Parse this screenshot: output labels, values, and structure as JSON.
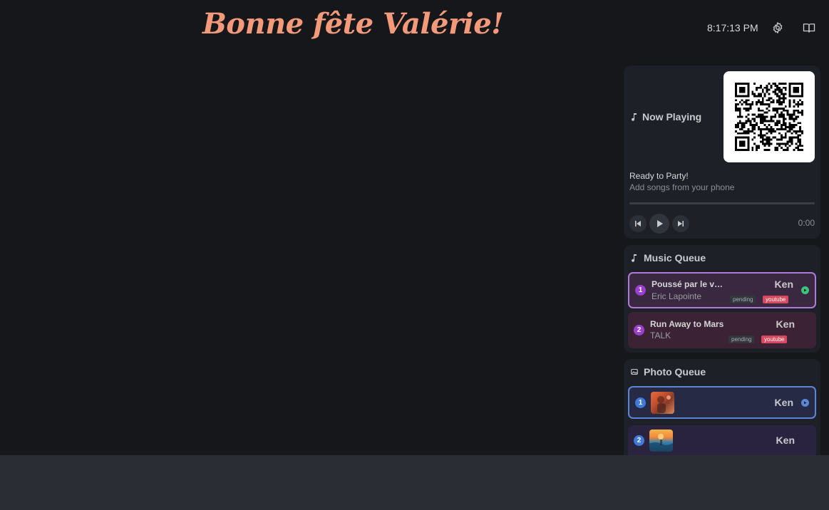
{
  "header": {
    "title": "Bonne fête Valérie!",
    "clock": "8:17:13 PM",
    "icons": [
      "gear-icon",
      "book-icon"
    ]
  },
  "now_playing": {
    "title": "Now Playing",
    "status": "Ready to Party!",
    "subtitle": "Add songs from your phone",
    "time": "0:00",
    "progress": 0
  },
  "music_queue": {
    "title": "Music Queue",
    "items": [
      {
        "position": "1",
        "song": "Poussé par le vent",
        "artist": "Eric Lapointe",
        "by": "Ken",
        "status": "pending",
        "source": "youtube",
        "current": true
      },
      {
        "position": "2",
        "song": "Run Away to Mars",
        "artist": "TALK",
        "by": "Ken",
        "status": "pending",
        "source": "youtube",
        "current": false
      }
    ]
  },
  "photo_queue": {
    "title": "Photo Queue",
    "items": [
      {
        "position": "1",
        "by": "Ken",
        "current": true
      },
      {
        "position": "2",
        "by": "Ken",
        "current": false
      }
    ]
  },
  "colors": {
    "title": "#f49a7a",
    "music_accent": "#b07ad8",
    "photo_accent": "#5b86d6",
    "youtube": "#d8495f",
    "playing": "#3dc47a"
  }
}
